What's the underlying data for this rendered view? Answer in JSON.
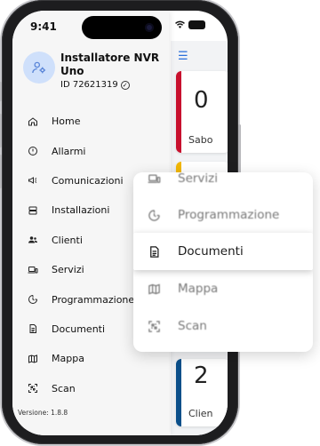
{
  "status": {
    "time": "9:41"
  },
  "user": {
    "name": "Installatore NVR Uno",
    "id_label": "ID 72621319"
  },
  "menu": [
    {
      "label": "Home",
      "icon": "home-icon"
    },
    {
      "label": "Allarmi",
      "icon": "alert-icon"
    },
    {
      "label": "Comunicazioni",
      "icon": "megaphone-icon"
    },
    {
      "label": "Installazioni",
      "icon": "server-icon"
    },
    {
      "label": "Clienti",
      "icon": "users-icon"
    },
    {
      "label": "Servizi",
      "icon": "devices-icon"
    },
    {
      "label": "Programmazione",
      "icon": "schedule-icon"
    },
    {
      "label": "Documenti",
      "icon": "document-icon"
    },
    {
      "label": "Mappa",
      "icon": "map-icon"
    },
    {
      "label": "Scan",
      "icon": "scan-icon"
    }
  ],
  "version": "Versione: 1.8.8",
  "background_cards": [
    {
      "number": "0",
      "label": "Sabo",
      "accent": "#c8102e"
    },
    {
      "number": "",
      "label": "",
      "accent": "#f2b705"
    },
    {
      "number": "2",
      "label": "Clien",
      "accent": "#0b4f8a"
    }
  ],
  "popup": [
    {
      "label": "Servizi",
      "icon": "devices-icon"
    },
    {
      "label": "Programmazione",
      "icon": "schedule-icon"
    },
    {
      "label": "Documenti",
      "icon": "document-icon",
      "selected": true
    },
    {
      "label": "Mappa",
      "icon": "map-icon"
    },
    {
      "label": "Scan",
      "icon": "scan-icon"
    }
  ]
}
